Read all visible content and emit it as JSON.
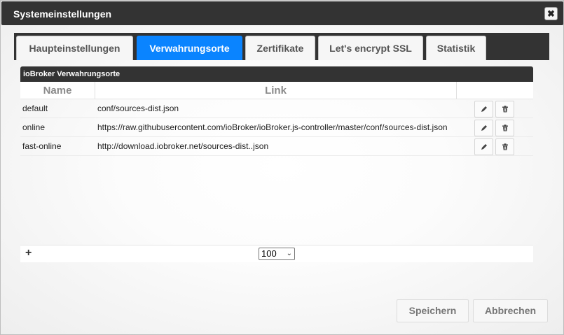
{
  "dialog": {
    "title": "Systemeinstellungen",
    "close_glyph": "✖"
  },
  "tabs": [
    {
      "label": "Haupteinstellungen",
      "active": false
    },
    {
      "label": "Verwahrungsorte",
      "active": true
    },
    {
      "label": "Zertifikate",
      "active": false
    },
    {
      "label": "Let's encrypt SSL",
      "active": false
    },
    {
      "label": "Statistik",
      "active": false
    }
  ],
  "panel": {
    "title": "ioBroker Verwahrungsorte",
    "columns": {
      "name": "Name",
      "link": "Link",
      "actions": ""
    },
    "rows": [
      {
        "name": "default",
        "link": "conf/sources-dist.json"
      },
      {
        "name": "online",
        "link": "https://raw.githubusercontent.com/ioBroker/ioBroker.js-controller/master/conf/sources-dist.json"
      },
      {
        "name": "fast-online",
        "link": "http://download.iobroker.net/sources-dist..json"
      }
    ],
    "row_actions": {
      "edit_icon": "pencil-icon",
      "delete_icon": "trash-icon"
    }
  },
  "footer": {
    "add_label": "+",
    "page_size": "100"
  },
  "buttons": {
    "save": "Speichern",
    "cancel": "Abbrechen"
  },
  "colors": {
    "titlebar": "#333333",
    "active_tab": "#0a84ff"
  }
}
